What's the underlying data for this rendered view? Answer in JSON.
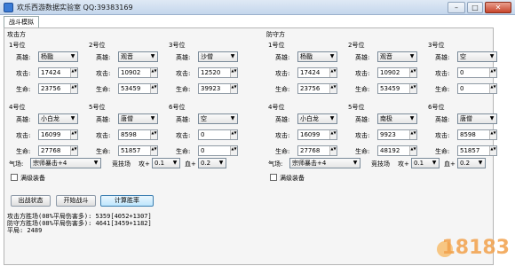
{
  "window": {
    "title": "欢乐西游数据实验室 QQ:39383169",
    "btn_min": "–",
    "btn_max": "□",
    "btn_close": "✕"
  },
  "tabs": {
    "active": "战斗模拟"
  },
  "attack": {
    "title": "攻击方",
    "positions": [
      {
        "label": "1号位",
        "hero_label": "英雄:",
        "hero": "杨戬",
        "atk_label": "攻击:",
        "atk": "17424",
        "hp_label": "生命:",
        "hp": "23756"
      },
      {
        "label": "2号位",
        "hero_label": "英雄:",
        "hero": "观音",
        "atk_label": "攻击:",
        "atk": "10902",
        "hp_label": "生命:",
        "hp": "53459"
      },
      {
        "label": "3号位",
        "hero_label": "英雄:",
        "hero": "沙僧",
        "atk_label": "攻击:",
        "atk": "12520",
        "hp_label": "生命:",
        "hp": "39923"
      },
      {
        "label": "4号位",
        "hero_label": "英雄:",
        "hero": "小白龙",
        "atk_label": "攻击:",
        "atk": "16099",
        "hp_label": "生命:",
        "hp": "27768"
      },
      {
        "label": "5号位",
        "hero_label": "英雄:",
        "hero": "唐僧",
        "atk_label": "攻击:",
        "atk": "8598",
        "hp_label": "生命:",
        "hp": "51857"
      },
      {
        "label": "6号位",
        "hero_label": "英雄:",
        "hero": "空",
        "atk_label": "攻击:",
        "atk": "0",
        "hp_label": "生命:",
        "hp": "0"
      }
    ],
    "qichang_label": "气场:",
    "qichang": "宗师暴击+4",
    "arena_label": "竞技场",
    "atk_plus_label": "攻+",
    "atk_plus": "0.1",
    "hp_plus_label": "血+",
    "hp_plus": "0.2",
    "full_equip_label": "满级装备"
  },
  "defend": {
    "title": "防守方",
    "positions": [
      {
        "label": "1号位",
        "hero_label": "英雄:",
        "hero": "杨戬",
        "atk_label": "攻击:",
        "atk": "17424",
        "hp_label": "生命:",
        "hp": "23756"
      },
      {
        "label": "2号位",
        "hero_label": "英雄:",
        "hero": "观音",
        "atk_label": "攻击:",
        "atk": "10902",
        "hp_label": "生命:",
        "hp": "53459"
      },
      {
        "label": "3号位",
        "hero_label": "英雄:",
        "hero": "空",
        "atk_label": "攻击:",
        "atk": "0",
        "hp_label": "生命:",
        "hp": "0"
      },
      {
        "label": "4号位",
        "hero_label": "英雄:",
        "hero": "小白龙",
        "atk_label": "攻击:",
        "atk": "16099",
        "hp_label": "生命:",
        "hp": "27768"
      },
      {
        "label": "5号位",
        "hero_label": "英雄:",
        "hero": "南极",
        "atk_label": "攻击:",
        "atk": "9923",
        "hp_label": "生命:",
        "hp": "48192"
      },
      {
        "label": "6号位",
        "hero_label": "英雄:",
        "hero": "唐僧",
        "atk_label": "攻击:",
        "atk": "8598",
        "hp_label": "生命:",
        "hp": "51857"
      }
    ],
    "qichang_label": "气场:",
    "qichang": "宗师暴击+4",
    "arena_label": "竞技场",
    "atk_plus_label": "攻+",
    "atk_plus": "0.1",
    "hp_plus_label": "血+",
    "hp_plus": "0.2",
    "full_equip_label": "满级装备"
  },
  "actions": {
    "status": "出战状态",
    "start": "开始战斗",
    "calc": "计算胜率"
  },
  "results": {
    "line1": "攻击方胜场(08%平局伤害多): 5359[4052+1307]",
    "line2": "防守方胜场(08%平局伤害多): 4641[3459+1182]",
    "line3": "平局: 2489"
  },
  "watermark": "18183"
}
